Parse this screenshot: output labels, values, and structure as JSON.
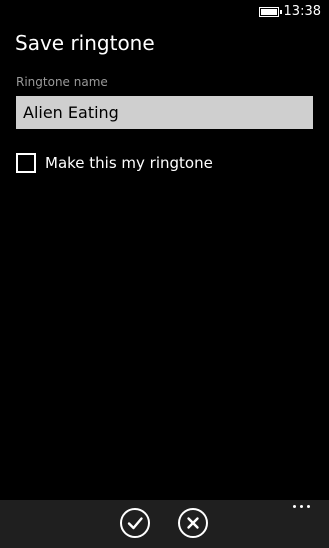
{
  "status_bar": {
    "time": "13:38",
    "battery_icon": "battery-full-icon"
  },
  "page": {
    "title": "Save ringtone"
  },
  "form": {
    "name_label": "Ringtone name",
    "name_value": "Alien Eating",
    "checkbox_label": "Make this my ringtone",
    "checkbox_checked": false
  },
  "app_bar": {
    "buttons": [
      {
        "icon": "checkmark-icon",
        "label": "save"
      },
      {
        "icon": "close-icon",
        "label": "cancel"
      }
    ],
    "more_icon": "more-ellipsis-icon"
  }
}
